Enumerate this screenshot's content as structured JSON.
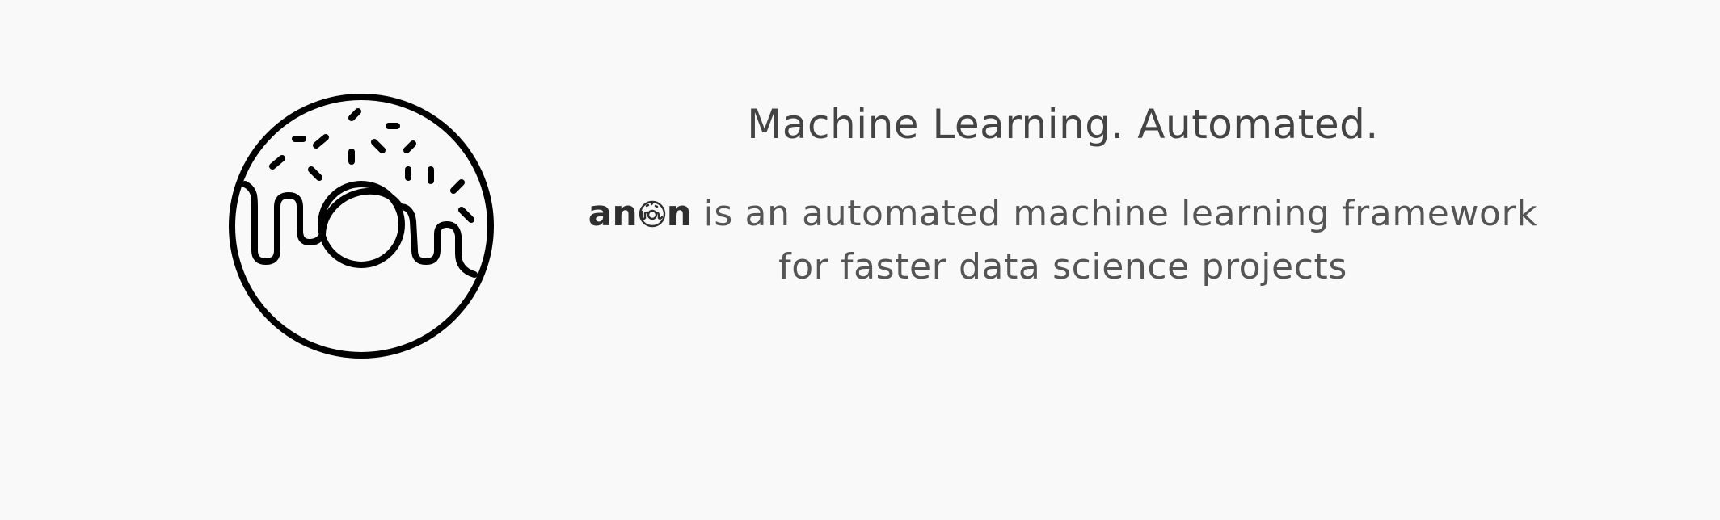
{
  "hero": {
    "headline": "Machine Learning. Automated.",
    "wordmark_prefix": "an",
    "wordmark_suffix": "n",
    "tagline_line1": "is an automated machine learning framework",
    "tagline_line2": "for faster data science projects"
  },
  "icons": {
    "logo": "donut-logo-icon",
    "wordmark_o": "donut-mini-icon"
  },
  "colors": {
    "background": "#f9f9f9",
    "headline": "#444444",
    "body_text": "#555555",
    "logo_stroke": "#000000"
  }
}
